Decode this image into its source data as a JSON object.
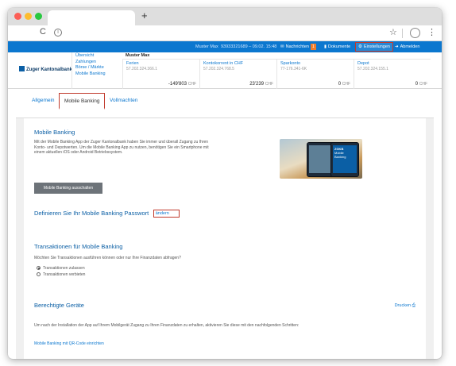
{
  "browser": {
    "new_tab": "+",
    "reload": "C",
    "star": "☆",
    "menu": "⋮"
  },
  "topnav": {
    "user": "Muster Max",
    "session": "93933321689 – 09.02. 15:48",
    "messages_label": "Nachrichten",
    "messages_count": "1",
    "documents_label": "Dokumente",
    "settings_label": "Einstellungen",
    "logout_label": "Abmelden"
  },
  "bank": {
    "name": "Zuger Kantonalbank"
  },
  "account_menu": [
    "Übersicht",
    "Zahlungen",
    "Börse / Märkte",
    "Mobile Banking"
  ],
  "account_owner": "Muster Max",
  "accounts": [
    {
      "name": "Ferien",
      "number": "57.202.324.366.1",
      "balance": "-149'803",
      "currency": "CHF"
    },
    {
      "name": "Kontokorrent in CHF",
      "number": "57.202.324.768.5",
      "balance": "23'239",
      "currency": "CHF"
    },
    {
      "name": "Sparkonto",
      "number": "77-176.341-6K",
      "balance": "0",
      "currency": "CHF"
    },
    {
      "name": "Depot",
      "number": "57.202.324.155.1",
      "balance": "0",
      "currency": "CHF"
    }
  ],
  "subtabs": [
    "Allgemein",
    "Mobile Banking",
    "Vollmachten"
  ],
  "mobile": {
    "title": "Mobile Banking",
    "desc_1": "Mit der Mobile Banking App der Zuger Kantonalbank haben Sie immer und überall Zugang zu Ihren",
    "desc_2": "Konto- und Depotwerten. Um die Mobile Banking App zu nutzen, benötigen Sie ein Smartphone mit",
    "desc_3": "einem aktuellen iOS oder Android Betriebssystem.",
    "phone_logo": "ZGKB",
    "phone_text_1": "Mobile",
    "phone_text_2": "Banking",
    "disable_button": "Mobile Banking ausschalten"
  },
  "password": {
    "title": "Definieren Sie Ihr Mobile Banking Passwort",
    "change_link": "ändern"
  },
  "transactions": {
    "title": "Transaktionen für Mobile Banking",
    "question": "Möchten Sie Transaktionen ausführen können oder nur Ihre Finanzdaten abfragen?",
    "option_allow": "Transaktionen zulassen",
    "option_deny": "Transaktionen verbieten"
  },
  "devices": {
    "title": "Berechtigte Geräte",
    "print_label": "Drucken",
    "desc": "Um nach der Installation der App auf Ihrem Mobilgerät Zugang zu Ihren Finanzdaten zu erhalten, aktivieren Sie diese mit den nachfolgenden Schritten:",
    "qr_link": "Mobile Banking mit QR-Code einrichten"
  }
}
